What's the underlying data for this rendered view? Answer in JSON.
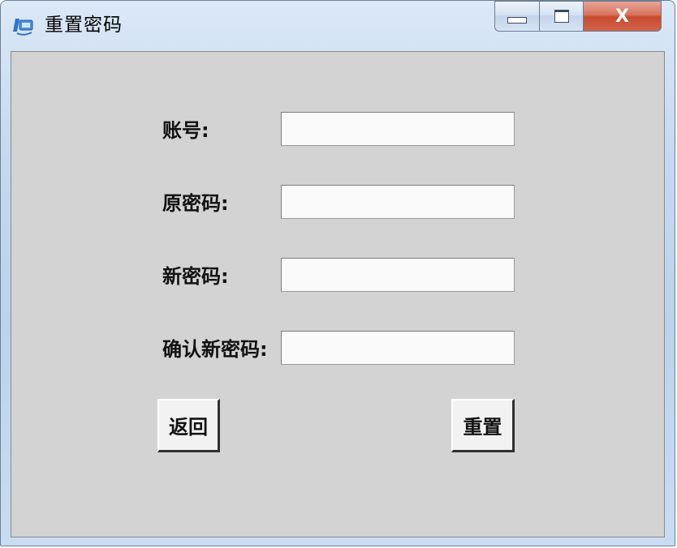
{
  "window": {
    "title": "重置密码",
    "close_symbol": "X"
  },
  "form": {
    "account_label": "账号:",
    "account_value": "",
    "old_password_label": "原密码:",
    "old_password_value": "",
    "new_password_label": "新密码:",
    "new_password_value": "",
    "confirm_password_label": "确认新密码:",
    "confirm_password_value": ""
  },
  "buttons": {
    "back_label": "返回",
    "reset_label": "重置"
  },
  "colors": {
    "client_background": "#d3d3d3",
    "close_button": "#c84a2f"
  },
  "icons": {
    "app": "app-icon",
    "minimize": "minimize-icon",
    "maximize": "maximize-icon",
    "close": "close-icon"
  }
}
